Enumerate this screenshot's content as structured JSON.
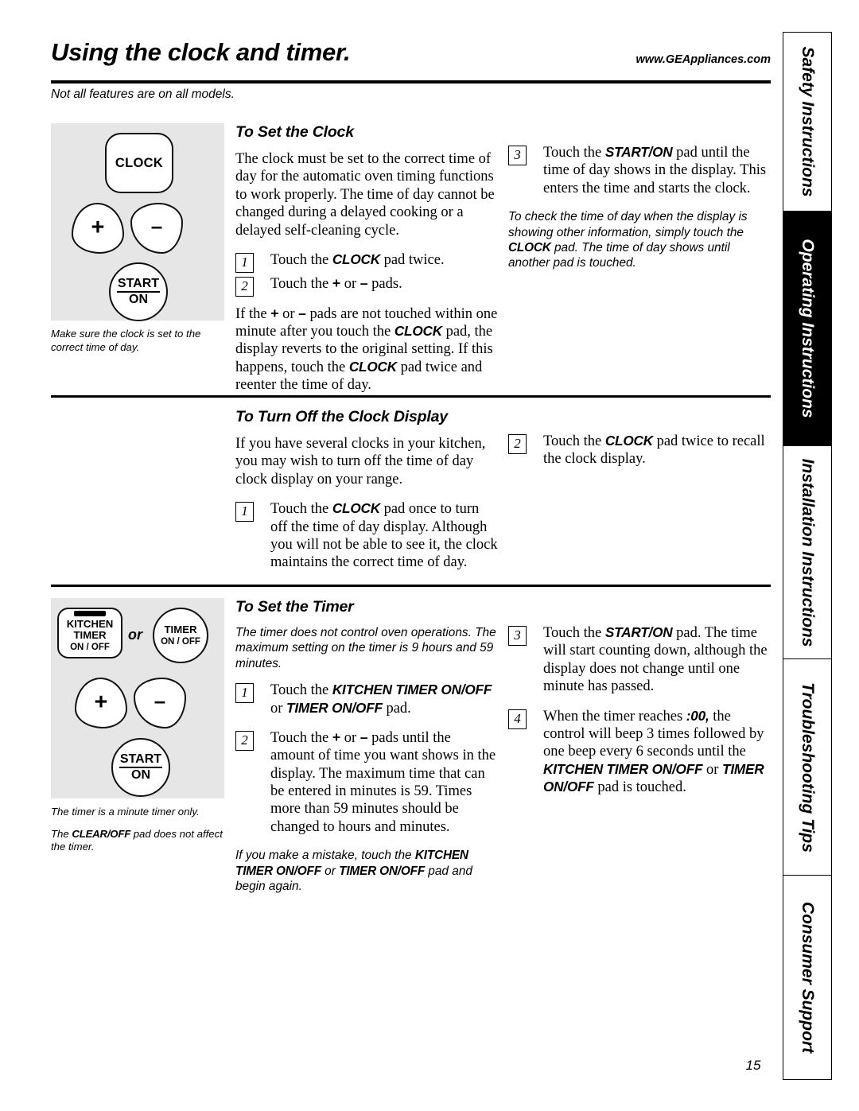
{
  "header": {
    "title": "Using the clock and timer.",
    "site_url": "www.GEAppliances.com",
    "subtitle": "Not all features are on all models."
  },
  "side_tabs": [
    {
      "label": "Safety Instructions",
      "active": false
    },
    {
      "label": "Operating Instructions",
      "active": true
    },
    {
      "label": "Installation Instructions",
      "active": false
    },
    {
      "label": "Troubleshooting Tips",
      "active": false
    },
    {
      "label": "Consumer Support",
      "active": false
    }
  ],
  "clock_section": {
    "heading": "To Set the Clock",
    "illustration": {
      "clock_pad": "CLOCK",
      "plus_pad": "+",
      "minus_pad": "–",
      "start_line1": "START",
      "start_line2": "ON",
      "caption": "Make sure the clock is set to the correct time of day."
    },
    "intro": "The clock must be set to the correct time of day for the automatic oven timing functions to work properly. The time of day cannot be changed during a delayed cooking or a delayed self-cleaning cycle.",
    "step1_num": "1",
    "step1_a": "Touch the ",
    "step1_pad": "CLOCK",
    "step1_b": " pad twice.",
    "step2_num": "2",
    "step2_a": "Touch the ",
    "step2_plus": "+",
    "step2_mid": " or ",
    "step2_minus": "–",
    "step2_b": " pads.",
    "follow_a": "If the ",
    "follow_plus": "+",
    "follow_mid1": " or ",
    "follow_minus": "–",
    "follow_b": " pads are not touched within one minute after you touch the ",
    "follow_pad1": "CLOCK",
    "follow_c": " pad, the display reverts to the original setting. If this happens, touch the ",
    "follow_pad2": "CLOCK",
    "follow_d": " pad twice and reenter the time of day.",
    "step3_num": "3",
    "step3_a": "Touch the ",
    "step3_pad": "START/ON",
    "step3_b": " pad until the time of day shows in the display. This enters the time and starts the clock.",
    "note_a": "To check the time of day when the display is showing other information, simply touch the ",
    "note_pad": "CLOCK",
    "note_b": " pad. The time of day shows until another pad is touched."
  },
  "clock_display_section": {
    "heading": "To Turn Off the Clock Display",
    "intro": "If you have several clocks in your kitchen, you may wish to turn off the time of day clock display on your range.",
    "step1_num": "1",
    "step1_a": "Touch the ",
    "step1_pad": "CLOCK",
    "step1_b": " pad once to turn off the time of day display. Although you will not be able to see it, the clock maintains the correct time of day.",
    "step2_num": "2",
    "step2_a": "Touch the ",
    "step2_pad": "CLOCK",
    "step2_b": " pad twice to recall the clock display."
  },
  "timer_section": {
    "heading": "To Set the Timer",
    "illustration": {
      "kitchen_timer_l1": "KITCHEN",
      "kitchen_timer_l2": "TIMER",
      "kitchen_timer_onoff": "ON / OFF",
      "or_label": "or",
      "timer_l1": "TIMER",
      "timer_onoff": "ON / OFF",
      "plus_pad": "+",
      "minus_pad": "–",
      "start_line1": "START",
      "start_line2": "ON",
      "caption1": "The timer is a minute timer only.",
      "caption2_a": "The ",
      "caption2_pad": "CLEAR/OFF",
      "caption2_b": " pad does not affect the timer."
    },
    "intro_note": "The timer does not control oven operations. The maximum setting on the timer is 9 hours and 59 minutes.",
    "step1_num": "1",
    "step1_a": "Touch the ",
    "step1_pad1": "KITCHEN TIMER ON/OFF",
    "step1_mid": " or ",
    "step1_pad2": "TIMER ON/OFF",
    "step1_b": " pad.",
    "step2_num": "2",
    "step2_a": "Touch the ",
    "step2_plus": "+",
    "step2_mid": " or ",
    "step2_minus": "–",
    "step2_b": " pads until the amount of time you want shows in the display. The maximum time that can be entered in minutes is 59. Times more than 59 minutes should be changed to hours and minutes.",
    "mistake_a": "If you make a mistake, touch the ",
    "mistake_pad1": "KITCHEN TIMER ON/OFF",
    "mistake_mid": " or ",
    "mistake_pad2": "TIMER ON/OFF",
    "mistake_b": " pad and begin again.",
    "step3_num": "3",
    "step3_a": "Touch the ",
    "step3_pad": "START/ON",
    "step3_b": " pad. The time will start counting down, although the display does not change until one minute has passed.",
    "step4_num": "4",
    "step4_a": "When the timer reaches ",
    "step4_zero": ":00,",
    "step4_b": " the control will beep 3 times followed by one beep every 6 seconds until the ",
    "step4_pad1": "KITCHEN TIMER ON/OFF",
    "step4_mid": " or ",
    "step4_pad2": "TIMER ON/OFF",
    "step4_c": " pad is touched."
  },
  "page_number": "15"
}
